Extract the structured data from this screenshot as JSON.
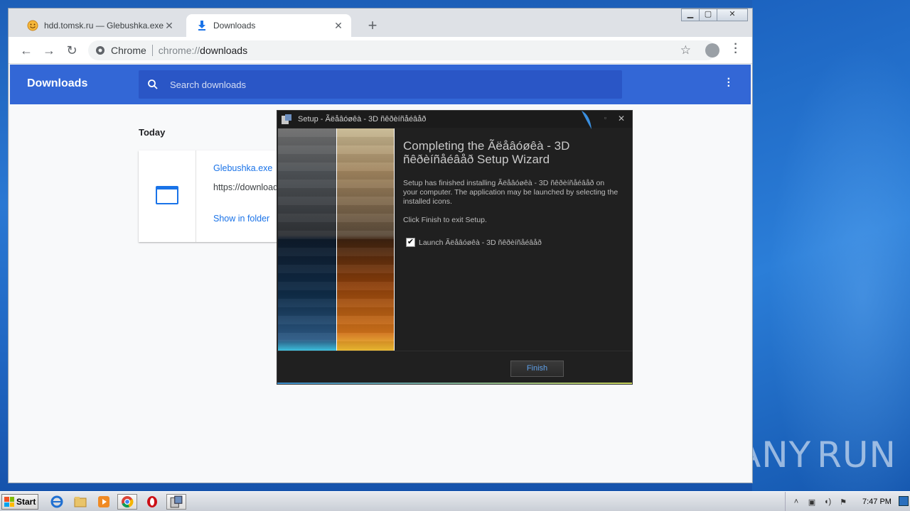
{
  "browser": {
    "tabs": [
      {
        "title": "hdd.tomsk.ru — Glebushka.exe",
        "active": false
      },
      {
        "title": "Downloads",
        "active": true
      }
    ],
    "omnibox": {
      "chip_label": "Chrome",
      "url_scheme": "chrome://",
      "url_path": "downloads"
    }
  },
  "downloads_page": {
    "title": "Downloads",
    "search_placeholder": "Search downloads",
    "section_label": "Today",
    "item": {
      "filename": "Glebushka.exe",
      "url": "https://download",
      "action_label": "Show in folder"
    }
  },
  "setup_dialog": {
    "title": "Setup - Ãëåâóøêà - 3D ñêðèíñåéâåð",
    "heading": "Completing the Ãëåâóøêà - 3D ñêðèíñåéâåð Setup Wizard",
    "body_installed": "Setup has finished installing Ãëåâóøêà - 3D ñêðèíñåéâåð on your computer. The application may be launched by selecting the installed icons.",
    "body_finish": "Click Finish to exit Setup.",
    "launch_checkbox_label": "Launch Ãëåâóøêà - 3D ñêðèíñåéâåð",
    "launch_checked": true,
    "finish_button": "Finish"
  },
  "taskbar": {
    "start_label": "Start",
    "clock": "7:47 PM",
    "pinned": [
      "internet-explorer-icon",
      "folder-icon",
      "media-player-icon",
      "chrome-icon",
      "opera-icon",
      "setup-icon"
    ]
  },
  "watermark": {
    "text_left": "ANY",
    "text_right": "RUN"
  },
  "colors": {
    "downloads_header": "#3367d6",
    "link_blue": "#1a73e8",
    "dialog_bg": "#202020",
    "finish_text": "#5fa0e8"
  }
}
